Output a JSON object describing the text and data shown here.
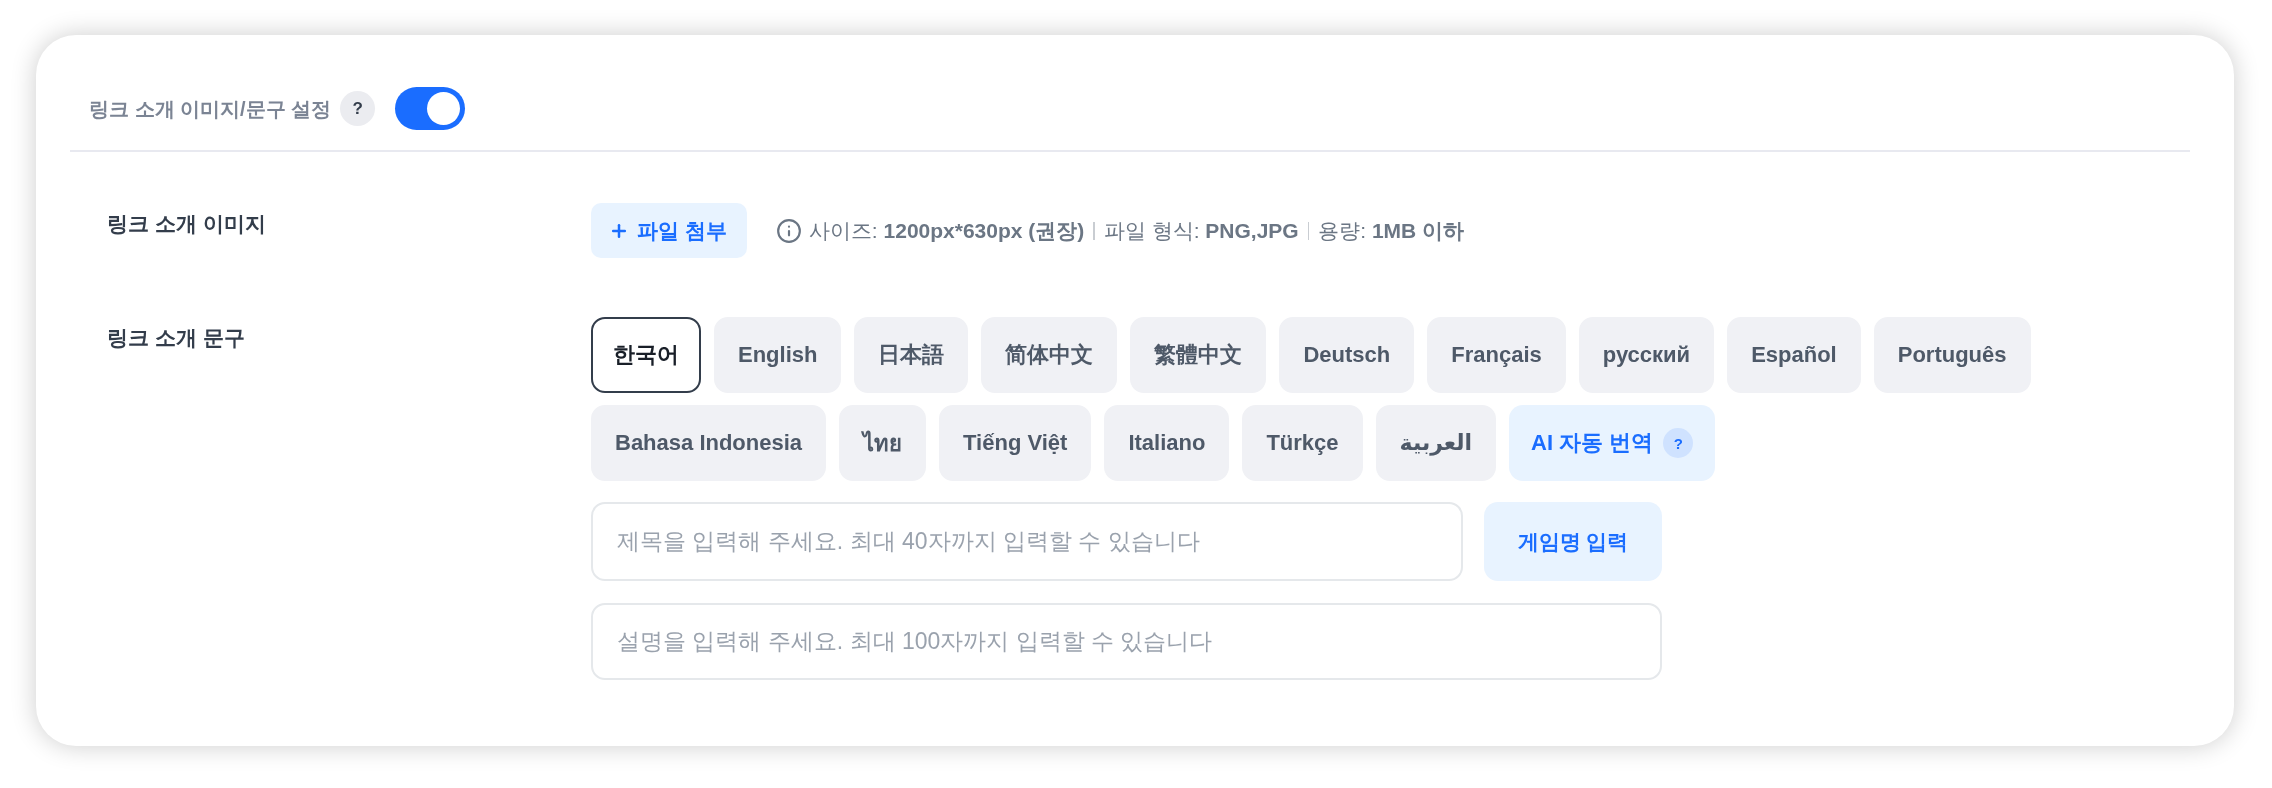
{
  "header": {
    "title": "링크 소개 이미지/문구 설정",
    "help": "?",
    "toggle": {
      "on": true
    }
  },
  "image_row": {
    "label": "링크 소개 이미지",
    "attach_button": "파일 첨부",
    "specs": [
      {
        "label": "사이즈:",
        "value": "1200px*630px (권장)"
      },
      {
        "label": "파일 형식:",
        "value": "PNG,JPG"
      },
      {
        "label": "용량:",
        "value": "1MB 이하"
      }
    ]
  },
  "text_row": {
    "label": "링크 소개 문구",
    "languages": [
      {
        "label": "한국어",
        "selected": true
      },
      {
        "label": "English",
        "selected": false
      },
      {
        "label": "日本語",
        "selected": false
      },
      {
        "label": "简体中文",
        "selected": false
      },
      {
        "label": "繁體中文",
        "selected": false
      },
      {
        "label": "Deutsch",
        "selected": false
      },
      {
        "label": "Français",
        "selected": false
      },
      {
        "label": "русский",
        "selected": false
      },
      {
        "label": "Español",
        "selected": false
      },
      {
        "label": "Português",
        "selected": false
      },
      {
        "label": "Bahasa Indonesia",
        "selected": false
      },
      {
        "label": "ไทย",
        "selected": false
      },
      {
        "label": "Tiếng Việt",
        "selected": false
      },
      {
        "label": "Italiano",
        "selected": false
      },
      {
        "label": "Türkçe",
        "selected": false
      },
      {
        "label": "العربية",
        "selected": false
      }
    ],
    "ai_translate": {
      "label": "AI 자동 번역",
      "help": "?"
    },
    "title_field": {
      "placeholder": "제목을 입력해 주세요. 최대 40자까지 입력할 수 있습니다"
    },
    "game_name_button": "게임명 입력",
    "description_field": {
      "placeholder": "설명을 입력해 주세요. 최대 100자까지 입력할 수 있습니다"
    }
  }
}
